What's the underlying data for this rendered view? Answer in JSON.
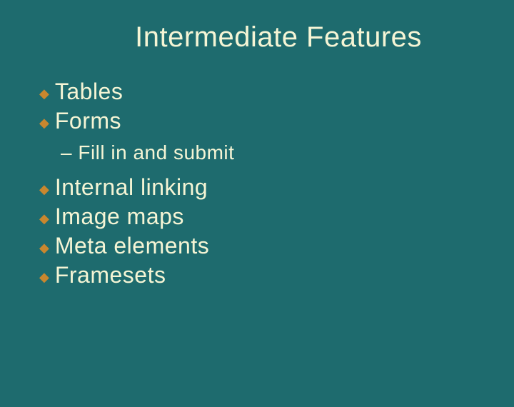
{
  "title": "Intermediate Features",
  "items": [
    {
      "text": "Tables"
    },
    {
      "text": "Forms"
    }
  ],
  "sub": "– Fill in and submit",
  "items2": [
    {
      "text": "Internal linking"
    },
    {
      "text": "Image maps"
    },
    {
      "text": "Meta elements"
    },
    {
      "text": "Framesets"
    }
  ]
}
